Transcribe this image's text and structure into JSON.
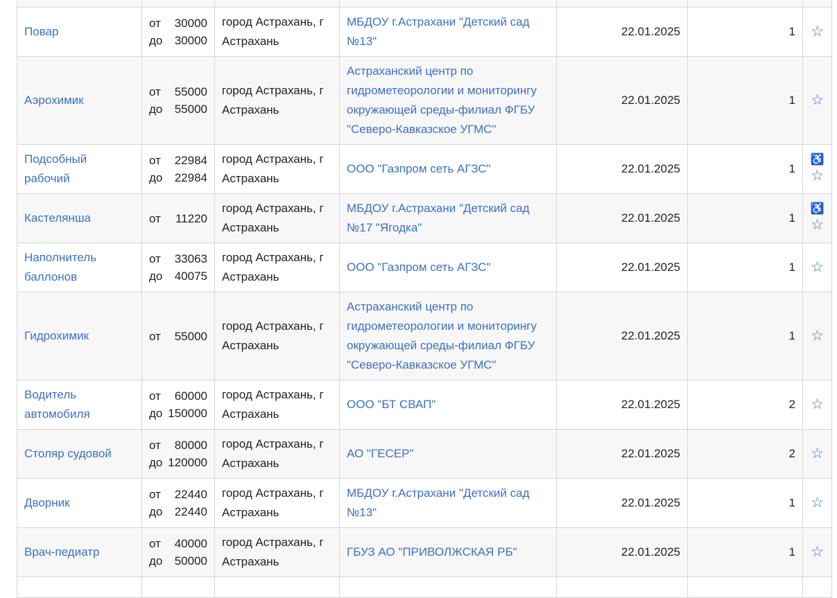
{
  "rows": [
    {
      "title": "",
      "from": "",
      "to": "",
      "location": "",
      "employer": "",
      "date": "",
      "count": "",
      "accessible": false,
      "empty": true
    },
    {
      "title": "Повар",
      "from": "30000",
      "to": "30000",
      "location": "город Астрахань, г Астрахань",
      "employer": "МБДОУ г.Астрахани \"Детский сад №13\"",
      "date": "22.01.2025",
      "count": "1",
      "accessible": false
    },
    {
      "title": "Аэрохимик",
      "from": "55000",
      "to": "55000",
      "location": "город Астрахань, г Астрахань",
      "employer": "Астраханский центр по гидрометеорологии и мониторингу окружающей среды-филиал ФГБУ \"Северо-Кавказское УГМС\"",
      "date": "22.01.2025",
      "count": "1",
      "accessible": false
    },
    {
      "title": "Подсобный рабочий",
      "from": "22984",
      "to": "22984",
      "location": "город Астрахань, г Астрахань",
      "employer": "ООО \"Газпром сеть АГЗС\"",
      "date": "22.01.2025",
      "count": "1",
      "accessible": true
    },
    {
      "title": "Кастелянша",
      "from": "11220",
      "to": "",
      "location": "город Астрахань, г Астрахань",
      "employer": "МБДОУ г.Астрахани \"Детский сад №17 \"Ягодка\"",
      "date": "22.01.2025",
      "count": "1",
      "accessible": true
    },
    {
      "title": "Наполнитель баллонов",
      "from": "33063",
      "to": "40075",
      "location": "город Астрахань, г Астрахань",
      "employer": "ООО \"Газпром сеть АГЗС\"",
      "date": "22.01.2025",
      "count": "1",
      "accessible": false
    },
    {
      "title": "Гидрохимик",
      "from": "55000",
      "to": "",
      "location": "город Астрахань, г Астрахань",
      "employer": "Астраханский центр по гидрометеорологии и мониторингу окружающей среды-филиал ФГБУ \"Северо-Кавказское УГМС\"",
      "date": "22.01.2025",
      "count": "1",
      "accessible": false
    },
    {
      "title": "Водитель автомобиля",
      "from": "60000",
      "to": "150000",
      "location": "город Астрахань, г Астрахань",
      "employer": "ООО \"БТ СВАП\"",
      "date": "22.01.2025",
      "count": "2",
      "accessible": false
    },
    {
      "title": "Столяр судовой",
      "from": "80000",
      "to": "120000",
      "location": "город Астрахань, г Астрахань",
      "employer": "АО \"ГЕСЕР\"",
      "date": "22.01.2025",
      "count": "2",
      "accessible": false
    },
    {
      "title": "Дворник",
      "from": "22440",
      "to": "22440",
      "location": "город Астрахань, г Астрахань",
      "employer": "МБДОУ г.Астрахани \"Детский сад №13\"",
      "date": "22.01.2025",
      "count": "1",
      "accessible": false
    },
    {
      "title": "Врач-педиатр",
      "from": "40000",
      "to": "50000",
      "location": "город Астрахань, г Астрахань",
      "employer": "ГБУЗ АО \"ПРИВОЛЖСКАЯ РБ\"",
      "date": "22.01.2025",
      "count": "1",
      "accessible": false
    },
    {
      "title": "",
      "from": "",
      "to": "",
      "location": "",
      "employer": "",
      "date": "",
      "count": "",
      "accessible": false,
      "empty": true
    }
  ],
  "labels": {
    "from_prefix": "от",
    "to_prefix": "до"
  },
  "icons": {
    "favorite": "star-outline-icon",
    "accessibility": "wheelchair-icon"
  },
  "colors": {
    "link": "#3d6fc4",
    "row_alt": "#f7f7f7",
    "border": "#d6d6d6"
  }
}
